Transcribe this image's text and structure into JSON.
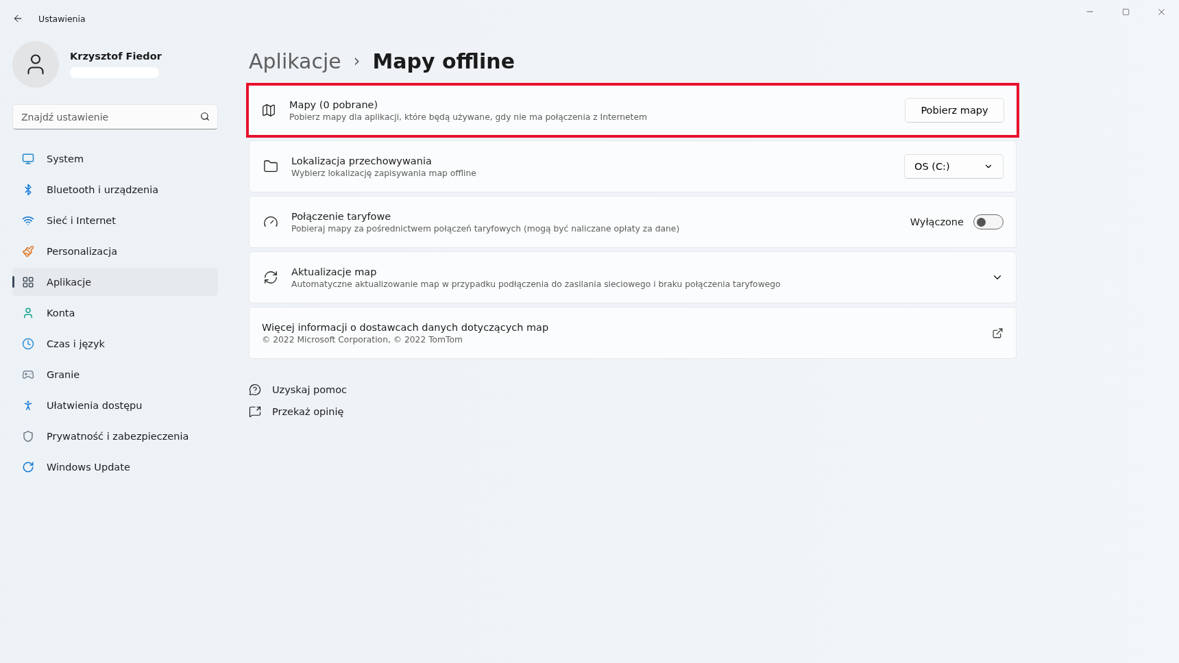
{
  "window": {
    "title": "Ustawienia"
  },
  "profile": {
    "name": "Krzysztof Fiedor"
  },
  "search": {
    "placeholder": "Znajdź ustawienie"
  },
  "sidebar": {
    "items": [
      {
        "label": "System",
        "kind": "system",
        "selected": false
      },
      {
        "label": "Bluetooth i urządzenia",
        "kind": "bluetooth",
        "selected": false
      },
      {
        "label": "Sieć i Internet",
        "kind": "wifi",
        "selected": false
      },
      {
        "label": "Personalizacja",
        "kind": "brush",
        "selected": false
      },
      {
        "label": "Aplikacje",
        "kind": "apps",
        "selected": true
      },
      {
        "label": "Konta",
        "kind": "account",
        "selected": false
      },
      {
        "label": "Czas i język",
        "kind": "time",
        "selected": false
      },
      {
        "label": "Granie",
        "kind": "gaming",
        "selected": false
      },
      {
        "label": "Ułatwienia dostępu",
        "kind": "accessibility",
        "selected": false
      },
      {
        "label": "Prywatność i zabezpieczenia",
        "kind": "shield",
        "selected": false
      },
      {
        "label": "Windows Update",
        "kind": "update",
        "selected": false
      }
    ]
  },
  "breadcrumb": {
    "parent": "Aplikacje",
    "separator": "›",
    "current": "Mapy offline"
  },
  "cards": [
    {
      "kind": "button",
      "title": "Mapy (0 pobrane)",
      "description": "Pobierz mapy dla aplikacji, które będą używane, gdy nie ma połączenia z Internetem",
      "button": "Pobierz mapy",
      "highlighted": true
    },
    {
      "kind": "dropdown",
      "title": "Lokalizacja przechowywania",
      "description": "Wybierz lokalizację zapisywania map offline",
      "value": "OS (C:)",
      "highlighted": false
    },
    {
      "kind": "toggle",
      "title": "Połączenie taryfowe",
      "description": "Pobieraj mapy za pośrednictwem połączeń taryfowych (mogą być naliczane opłaty za dane)",
      "state_label": "Wyłączone",
      "on": false,
      "highlighted": false
    },
    {
      "kind": "expander",
      "title": "Aktualizacje map",
      "description": "Automatyczne aktualizowanie map w przypadku podłączenia do zasilania sieciowego i braku połączenia taryfowego",
      "expanded": false,
      "highlighted": false
    },
    {
      "kind": "link",
      "title": "Więcej informacji o dostawcach danych dotyczących map",
      "description": "© 2022 Microsoft Corporation, © 2022 TomTom",
      "highlighted": false
    }
  ],
  "help_links": [
    {
      "kind": "help",
      "label": "Uzyskaj pomoc"
    },
    {
      "kind": "feedback",
      "label": "Przekaż opinię"
    }
  ]
}
